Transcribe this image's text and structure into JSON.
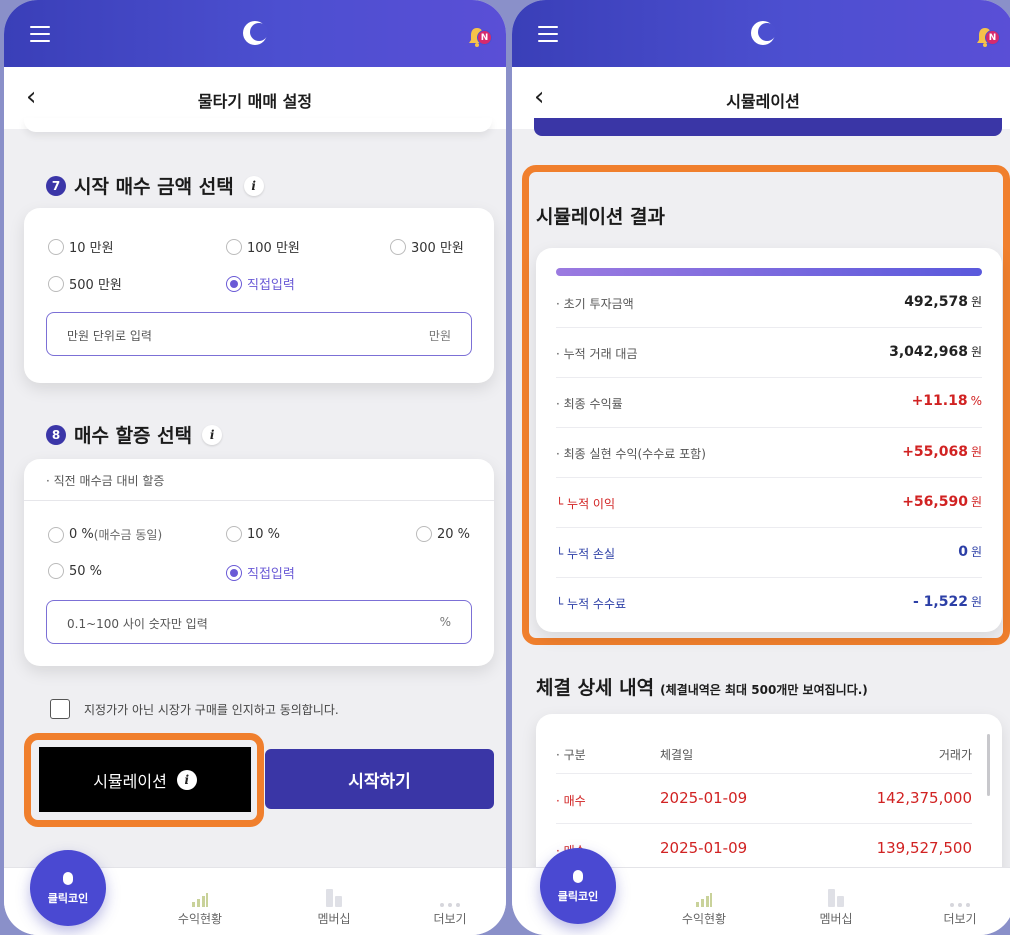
{
  "left": {
    "header_title": "물타기 매매 설정",
    "section7": {
      "num": "7",
      "title": "시작 매수 금액 선택",
      "info": "i",
      "options": [
        "10 만원",
        "100 만원",
        "300 만원",
        "500 만원",
        "직접입력"
      ],
      "selected": "직접입력",
      "input_placeholder": "만원 단위로 입력",
      "input_unit": "만원"
    },
    "section8": {
      "num": "8",
      "title": "매수 할증 선택",
      "info": "i",
      "subhead": "· 직전 매수금 대비 할증",
      "options": [
        {
          "value": "0 %",
          "sub": "(매수금 동일)"
        },
        {
          "value": "10 %",
          "sub": ""
        },
        {
          "value": "20 %",
          "sub": ""
        },
        {
          "value": "50 %",
          "sub": ""
        },
        {
          "value": "직접입력",
          "sub": ""
        }
      ],
      "selected": "직접입력",
      "input_placeholder": "0.1~100 사이 숫자만 입력",
      "input_unit": "%"
    },
    "agree_text": "지정가가 아닌 시장가 구매를 인지하고 동의합니다.",
    "simulation_label": "시뮬레이션",
    "simulation_info": "i",
    "start_label": "시작하기"
  },
  "right": {
    "header_title": "시뮬레이션",
    "result_title": "시뮬레이션 결과",
    "results": [
      {
        "label": "· 초기 투자금액",
        "value": "492,578",
        "unit": "원",
        "tone": "normal"
      },
      {
        "label": "· 누적 거래 대금",
        "value": "3,042,968",
        "unit": "원",
        "tone": "normal"
      },
      {
        "label": "· 최종 수익률",
        "value": "+11.18",
        "unit": "%",
        "tone": "red",
        "label_tone": "normal"
      },
      {
        "label": "· 최종 실현 수익(수수료 포함)",
        "value": "+55,068",
        "unit": "원",
        "tone": "red",
        "label_tone": "normal"
      },
      {
        "label": "└ 누적 이익",
        "value": "+56,590",
        "unit": "원",
        "tone": "red",
        "label_tone": "red"
      },
      {
        "label": "└ 누적 손실",
        "value": "0",
        "unit": "원",
        "tone": "blue",
        "label_tone": "blue"
      },
      {
        "label": "└ 누적 수수료",
        "value": "- 1,522",
        "unit": "원",
        "tone": "blue",
        "label_tone": "blue"
      }
    ],
    "detail_title": "체결 상세 내역",
    "detail_note": "(체결내역은 최대 500개만 보여집니다.)",
    "detail_columns": [
      "· 구분",
      "체결일",
      "거래가"
    ],
    "detail_rows": [
      {
        "type": "· 매수",
        "date": "2025-01-09",
        "price": "142,375,000"
      },
      {
        "type": "· 매수",
        "date": "2025-01-09",
        "price": "139,527,500"
      }
    ]
  },
  "nav": {
    "fab_label": "클릭코인",
    "items": [
      "수익현황",
      "멤버십",
      "더보기"
    ]
  },
  "colors": {
    "brand": "#3a36a6",
    "accent": "#6a5ad6",
    "highlight": "#f07f2d",
    "profit": "#d12222",
    "loss": "#2c3fa6"
  }
}
